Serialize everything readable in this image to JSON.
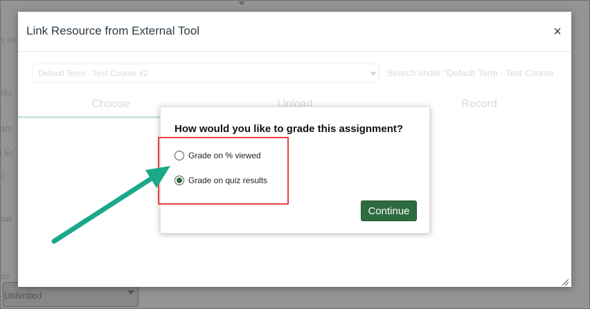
{
  "modal": {
    "title": "Link Resource from External Tool",
    "close_glyph": "×",
    "term_select_value": "Default Term - Test Course #2",
    "search_placeholder": "Search under \"Default Term - Test Course",
    "tabs": [
      {
        "label": "Choose"
      },
      {
        "label": "Upload"
      },
      {
        "label": "Record"
      }
    ]
  },
  "dialog": {
    "title": "How would you like to grade this assignment?",
    "options": [
      {
        "label": "Grade on % viewed",
        "checked": false
      },
      {
        "label": "Grade on quiz results",
        "checked": true
      }
    ],
    "continue_label": "Continue"
  },
  "background": {
    "fragments": [
      "s no",
      "stu",
      "arn",
      "l Er",
      "r",
      "ow",
      "ov",
      "Unlimited"
    ]
  },
  "colors": {
    "accent_green": "#2e6b3f",
    "highlight_red": "#e8413e",
    "arrow_teal": "#1aa88a",
    "tab_underline": "#0b8574"
  },
  "icons": {
    "close": "close-icon",
    "caret": "chevron-down-icon",
    "resize": "resize-grip-icon"
  }
}
